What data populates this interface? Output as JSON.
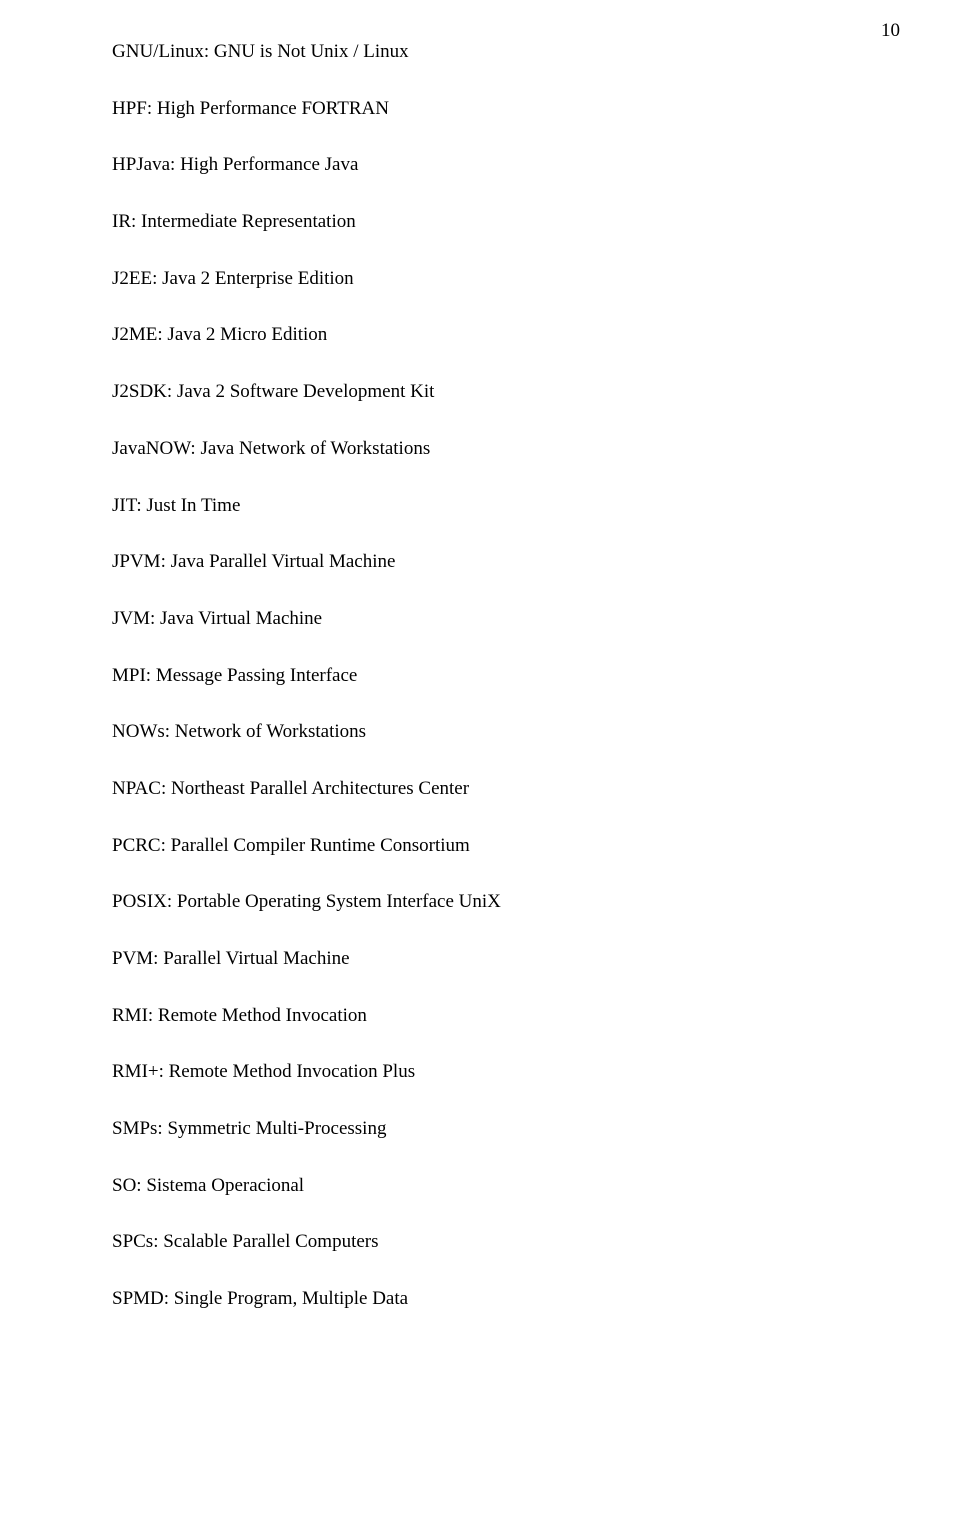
{
  "page_number": "10",
  "entries": [
    "GNU/Linux: GNU is Not Unix / Linux",
    "HPF: High Performance FORTRAN",
    "HPJava: High Performance Java",
    "IR: Intermediate Representation",
    "J2EE: Java 2 Enterprise Edition",
    "J2ME: Java 2 Micro Edition",
    "J2SDK: Java 2 Software Development Kit",
    "JavaNOW: Java Network of Workstations",
    "JIT: Just In Time",
    "JPVM: Java Parallel Virtual Machine",
    "JVM: Java Virtual Machine",
    "MPI: Message Passing Interface",
    "NOWs: Network of Workstations",
    "NPAC: Northeast Parallel Architectures Center",
    "PCRC: Parallel Compiler Runtime Consortium",
    "POSIX: Portable Operating System Interface UniX",
    "PVM: Parallel Virtual Machine",
    "RMI: Remote Method Invocation",
    "RMI+: Remote Method Invocation Plus",
    "SMPs: Symmetric Multi-Processing",
    "SO: Sistema Operacional",
    "SPCs: Scalable Parallel Computers",
    "SPMD: Single Program, Multiple Data"
  ]
}
